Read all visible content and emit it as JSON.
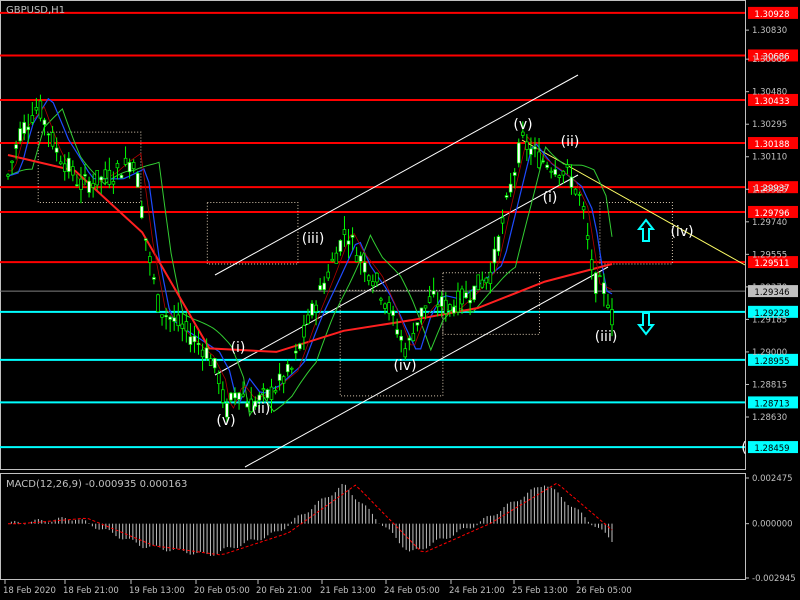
{
  "window_title": "GBPUSD,H1",
  "price_axis": {
    "ticks": [
      "1.30830",
      "1.30665",
      "1.30480",
      "1.30295",
      "1.30110",
      "1.29925",
      "1.29740",
      "1.29555",
      "1.29370",
      "1.29185",
      "1.29000",
      "1.28815",
      "1.28630"
    ],
    "min": 1.2834,
    "max": 1.3099
  },
  "levels": [
    {
      "label": "1.30928",
      "value": 1.30928,
      "color": "#ff0000",
      "kind": "resistance"
    },
    {
      "label": "1.30686",
      "value": 1.30686,
      "color": "#ff0000",
      "kind": "resistance"
    },
    {
      "label": "1.30433",
      "value": 1.30433,
      "color": "#ff0000",
      "kind": "resistance"
    },
    {
      "label": "1.30188",
      "value": 1.30188,
      "color": "#ff0000",
      "kind": "resistance"
    },
    {
      "label": "1.29937",
      "value": 1.29937,
      "color": "#ff0000",
      "kind": "resistance"
    },
    {
      "label": "1.29796",
      "value": 1.29796,
      "color": "#ff0000",
      "kind": "resistance"
    },
    {
      "label": "1.29511",
      "value": 1.29511,
      "color": "#ff0000",
      "kind": "resistance"
    },
    {
      "label": "1.29228",
      "value": 1.29228,
      "color": "#00ffff",
      "kind": "support"
    },
    {
      "label": "1.28955",
      "value": 1.28955,
      "color": "#00ffff",
      "kind": "support"
    },
    {
      "label": "1.28713",
      "value": 1.28713,
      "color": "#00ffff",
      "kind": "support"
    },
    {
      "label": "1.28459",
      "value": 1.28459,
      "color": "#00ffff",
      "kind": "support"
    }
  ],
  "current_price": {
    "label": "1.29346",
    "value": 1.29346
  },
  "time_axis": [
    "18 Feb 2020",
    "18 Feb 21:00",
    "19 Feb 13:00",
    "20 Feb 05:00",
    "20 Feb 21:00",
    "21 Feb 13:00",
    "24 Feb 05:00",
    "24 Feb 21:00",
    "25 Feb 13:00",
    "26 Feb 05:00"
  ],
  "wave_labels": [
    "(v)",
    "(ii)",
    "(iii)",
    "(i)",
    "(ii)",
    "(iv)",
    "(v)",
    "(i)",
    "(ii)",
    "(iii)",
    "(iv)",
    "("
  ],
  "macd": {
    "title": "MACD(12,26,9) -0.000935 0.000163",
    "ticks": [
      "0.002475",
      "0.000000",
      "-0.002945"
    ],
    "min": -0.002945,
    "max": 0.002475
  },
  "chart_data": {
    "type": "line",
    "symbol": "GBPUSD",
    "timeframe": "H1",
    "categories": [
      "18 Feb 2020",
      "18 Feb 21:00",
      "19 Feb 13:00",
      "20 Feb 05:00",
      "20 Feb 21:00",
      "21 Feb 13:00",
      "24 Feb 05:00",
      "24 Feb 21:00",
      "25 Feb 13:00",
      "26 Feb 05:00"
    ],
    "series": [
      {
        "values": [
          1.301,
          1.2995,
          1.2925,
          1.288,
          1.2905,
          1.295,
          1.2955,
          1.2945,
          1.301,
          1.292
        ]
      },
      {
        "values": [
          1.3012,
          1.3003,
          1.2968,
          1.2902,
          1.29,
          1.2912,
          1.2918,
          1.2925,
          1.294,
          1.295
        ]
      }
    ],
    "ylim": [
      1.2834,
      1.3099
    ],
    "grid": false,
    "horizontal_levels": [
      1.30928,
      1.30686,
      1.30433,
      1.30188,
      1.29937,
      1.29796,
      1.29511,
      1.29228,
      1.28955,
      1.28713,
      1.28459
    ],
    "last_price": 1.29346,
    "macd": {
      "params": "12,26,9",
      "main": -0.000935,
      "signal": 0.000163,
      "values": [
        0.0,
        0.0003,
        -0.0012,
        -0.0017,
        -0.0005,
        0.0021,
        -0.0016,
        0.0,
        0.0022,
        -0.0009
      ]
    }
  }
}
